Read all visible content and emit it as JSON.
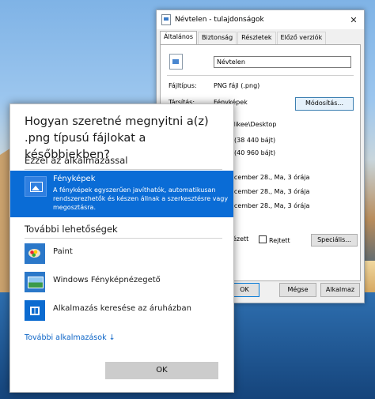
{
  "properties_window": {
    "title": "Névtelen - tulajdonságok",
    "close_glyph": "✕",
    "tabs": [
      "Általános",
      "Biztonság",
      "Részletek",
      "Előző verziók"
    ],
    "file_name": "Névtelen",
    "file_type_label": "Fájltípus:",
    "file_type_value": "PNG fájl (.png)",
    "opens_with_label": "Társítás:",
    "opens_with_value": "Fényképek",
    "change_button": "Módosítás...",
    "location_value": ":\\Mikee\\Desktop",
    "size_value": "(38 440 bájt)",
    "size_on_disk_value": "(40 960 bájt)",
    "created_value": "ecember 28., Ma, 3 órája",
    "modified_value": "ecember 28., Ma, 3 órája",
    "accessed_value": "ecember 28., Ma, 3 órája",
    "readonly_label": "ézett",
    "hidden_label": "Rejtett",
    "advanced_button": "Speciális...",
    "ok_button": "OK",
    "cancel_button": "Mégse",
    "apply_button": "Alkalmaz"
  },
  "dialog": {
    "question": "Hogyan szeretné megnyitni a(z) .png típusú fájlokat a későbbiekben?",
    "keep_section": "Ezzel az alkalmazással",
    "selected_app": {
      "name": "Fényképek",
      "description": "A fényképek egyszerűen javíthatók, automatikusan rendszerezhetők és készen állnak a szerkesztésre vagy megosztásra."
    },
    "more_section": "További lehetőségek",
    "apps": [
      {
        "name": "Paint",
        "icon": "paint-icon"
      },
      {
        "name": "Windows Fényképnézegető",
        "icon": "photo-viewer-icon"
      },
      {
        "name": "Alkalmazás keresése az áruházban",
        "icon": "store-icon"
      }
    ],
    "more_apps_link": "További alkalmazások ↓",
    "ok_button": "OK"
  }
}
